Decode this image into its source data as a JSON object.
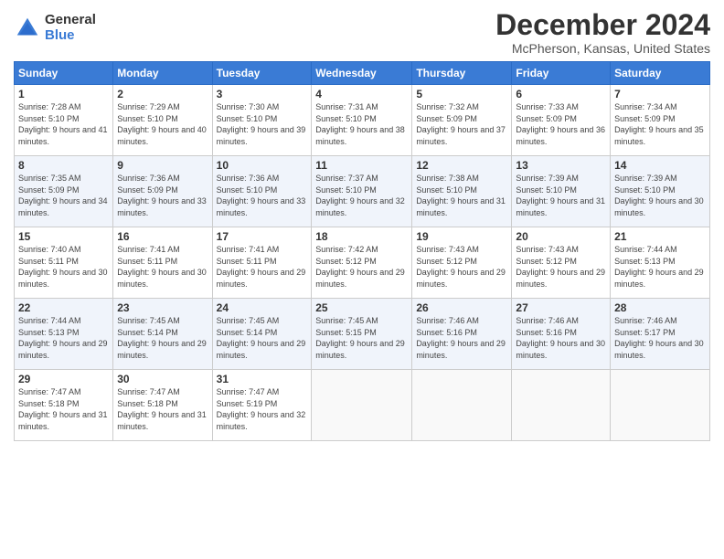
{
  "header": {
    "logo_general": "General",
    "logo_blue": "Blue",
    "title": "December 2024",
    "location": "McPherson, Kansas, United States"
  },
  "days_of_week": [
    "Sunday",
    "Monday",
    "Tuesday",
    "Wednesday",
    "Thursday",
    "Friday",
    "Saturday"
  ],
  "weeks": [
    [
      {
        "day": "1",
        "sunrise": "7:28 AM",
        "sunset": "5:10 PM",
        "daylight": "9 hours and 41 minutes."
      },
      {
        "day": "2",
        "sunrise": "7:29 AM",
        "sunset": "5:10 PM",
        "daylight": "9 hours and 40 minutes."
      },
      {
        "day": "3",
        "sunrise": "7:30 AM",
        "sunset": "5:10 PM",
        "daylight": "9 hours and 39 minutes."
      },
      {
        "day": "4",
        "sunrise": "7:31 AM",
        "sunset": "5:10 PM",
        "daylight": "9 hours and 38 minutes."
      },
      {
        "day": "5",
        "sunrise": "7:32 AM",
        "sunset": "5:09 PM",
        "daylight": "9 hours and 37 minutes."
      },
      {
        "day": "6",
        "sunrise": "7:33 AM",
        "sunset": "5:09 PM",
        "daylight": "9 hours and 36 minutes."
      },
      {
        "day": "7",
        "sunrise": "7:34 AM",
        "sunset": "5:09 PM",
        "daylight": "9 hours and 35 minutes."
      }
    ],
    [
      {
        "day": "8",
        "sunrise": "7:35 AM",
        "sunset": "5:09 PM",
        "daylight": "9 hours and 34 minutes."
      },
      {
        "day": "9",
        "sunrise": "7:36 AM",
        "sunset": "5:09 PM",
        "daylight": "9 hours and 33 minutes."
      },
      {
        "day": "10",
        "sunrise": "7:36 AM",
        "sunset": "5:10 PM",
        "daylight": "9 hours and 33 minutes."
      },
      {
        "day": "11",
        "sunrise": "7:37 AM",
        "sunset": "5:10 PM",
        "daylight": "9 hours and 32 minutes."
      },
      {
        "day": "12",
        "sunrise": "7:38 AM",
        "sunset": "5:10 PM",
        "daylight": "9 hours and 31 minutes."
      },
      {
        "day": "13",
        "sunrise": "7:39 AM",
        "sunset": "5:10 PM",
        "daylight": "9 hours and 31 minutes."
      },
      {
        "day": "14",
        "sunrise": "7:39 AM",
        "sunset": "5:10 PM",
        "daylight": "9 hours and 30 minutes."
      }
    ],
    [
      {
        "day": "15",
        "sunrise": "7:40 AM",
        "sunset": "5:11 PM",
        "daylight": "9 hours and 30 minutes."
      },
      {
        "day": "16",
        "sunrise": "7:41 AM",
        "sunset": "5:11 PM",
        "daylight": "9 hours and 30 minutes."
      },
      {
        "day": "17",
        "sunrise": "7:41 AM",
        "sunset": "5:11 PM",
        "daylight": "9 hours and 29 minutes."
      },
      {
        "day": "18",
        "sunrise": "7:42 AM",
        "sunset": "5:12 PM",
        "daylight": "9 hours and 29 minutes."
      },
      {
        "day": "19",
        "sunrise": "7:43 AM",
        "sunset": "5:12 PM",
        "daylight": "9 hours and 29 minutes."
      },
      {
        "day": "20",
        "sunrise": "7:43 AM",
        "sunset": "5:12 PM",
        "daylight": "9 hours and 29 minutes."
      },
      {
        "day": "21",
        "sunrise": "7:44 AM",
        "sunset": "5:13 PM",
        "daylight": "9 hours and 29 minutes."
      }
    ],
    [
      {
        "day": "22",
        "sunrise": "7:44 AM",
        "sunset": "5:13 PM",
        "daylight": "9 hours and 29 minutes."
      },
      {
        "day": "23",
        "sunrise": "7:45 AM",
        "sunset": "5:14 PM",
        "daylight": "9 hours and 29 minutes."
      },
      {
        "day": "24",
        "sunrise": "7:45 AM",
        "sunset": "5:14 PM",
        "daylight": "9 hours and 29 minutes."
      },
      {
        "day": "25",
        "sunrise": "7:45 AM",
        "sunset": "5:15 PM",
        "daylight": "9 hours and 29 minutes."
      },
      {
        "day": "26",
        "sunrise": "7:46 AM",
        "sunset": "5:16 PM",
        "daylight": "9 hours and 29 minutes."
      },
      {
        "day": "27",
        "sunrise": "7:46 AM",
        "sunset": "5:16 PM",
        "daylight": "9 hours and 30 minutes."
      },
      {
        "day": "28",
        "sunrise": "7:46 AM",
        "sunset": "5:17 PM",
        "daylight": "9 hours and 30 minutes."
      }
    ],
    [
      {
        "day": "29",
        "sunrise": "7:47 AM",
        "sunset": "5:18 PM",
        "daylight": "9 hours and 31 minutes."
      },
      {
        "day": "30",
        "sunrise": "7:47 AM",
        "sunset": "5:18 PM",
        "daylight": "9 hours and 31 minutes."
      },
      {
        "day": "31",
        "sunrise": "7:47 AM",
        "sunset": "5:19 PM",
        "daylight": "9 hours and 32 minutes."
      },
      null,
      null,
      null,
      null
    ]
  ]
}
